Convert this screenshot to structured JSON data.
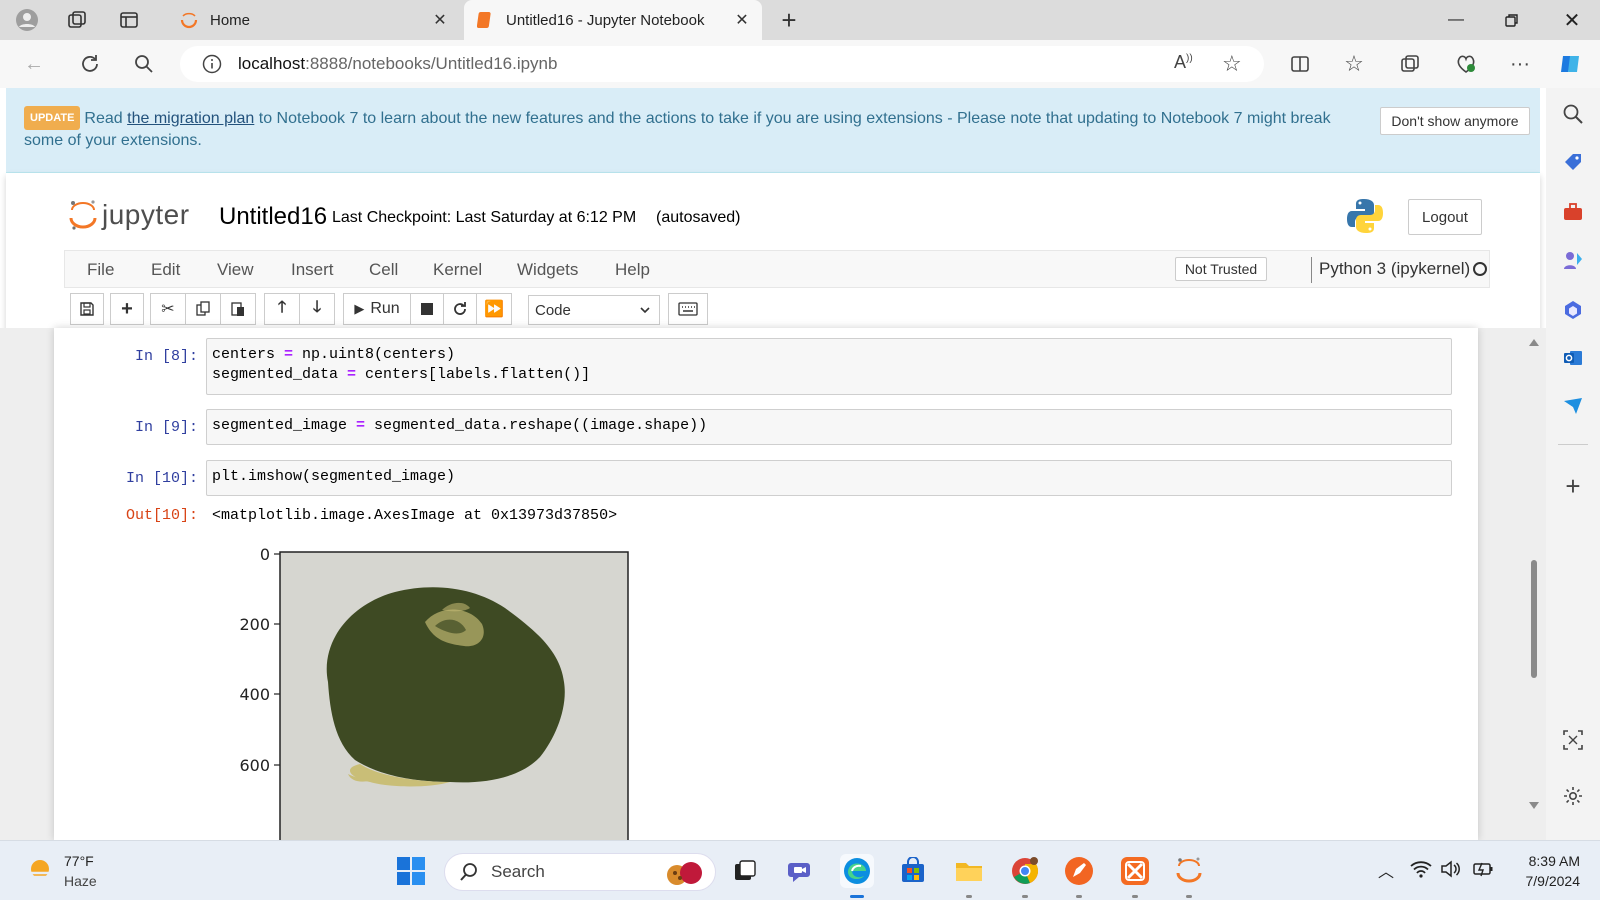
{
  "browser": {
    "tabs": [
      {
        "title": "Home"
      },
      {
        "title": "Untitled16 - Jupyter Notebook"
      }
    ],
    "url_host": "localhost",
    "url_path": ":8888/notebooks/Untitled16.ipynb"
  },
  "banner": {
    "badge": "UPDATE",
    "text_before": "Read ",
    "link": "the migration plan",
    "text_after": " to Notebook 7 to learn about the new features and the actions to take if you are using extensions - Please note that updating to Notebook 7 might break some of your extensions.",
    "dismiss_label": "Don't show anymore"
  },
  "notebook": {
    "logo_word": "jupyter",
    "title": "Untitled16",
    "checkpoint": "Last Checkpoint: Last Saturday at 6:12 PM",
    "autosave": "(autosaved)",
    "logout_label": "Logout",
    "menu": [
      "File",
      "Edit",
      "View",
      "Insert",
      "Cell",
      "Kernel",
      "Widgets",
      "Help"
    ],
    "trust_label": "Not Trusted",
    "kernel_name": "Python 3 (ipykernel)",
    "toolbar": {
      "run_label": "Run",
      "cell_type": "Code"
    }
  },
  "cells": [
    {
      "prompt": "In [8]:",
      "lines": [
        {
          "a": "centers ",
          "op": "=",
          "b": " np.uint8(centers)"
        },
        {
          "a": "segmented_data ",
          "op": "=",
          "b": " centers[labels.flatten()]"
        }
      ]
    },
    {
      "prompt": "In [9]:",
      "lines": [
        {
          "a": "segmented_image ",
          "op": "=",
          "b": " segmented_data.reshape((image.shape))"
        }
      ]
    },
    {
      "prompt": "In [10]:",
      "lines": [
        {
          "a": "plt.imshow(segmented_image)",
          "op": "",
          "b": ""
        }
      ]
    }
  ],
  "output": {
    "prompt": "Out[10]:",
    "text": "<matplotlib.image.AxesImage at 0x13973d37850>"
  },
  "plot": {
    "y_ticks": [
      "0",
      "200",
      "400",
      "600"
    ],
    "colors": {
      "background": "#d6d6d0",
      "segment_dark": "#3e4a23",
      "segment_light": "#c9be77"
    }
  },
  "taskbar": {
    "weather_temp": "77°F",
    "weather_cond": "Haze",
    "search_placeholder": "Search",
    "time": "8:39 AM",
    "date": "7/9/2024"
  }
}
